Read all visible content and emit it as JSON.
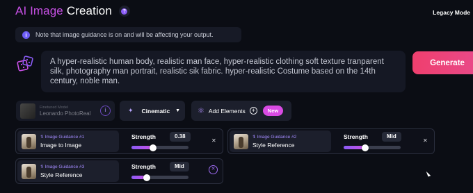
{
  "header": {
    "title_accent": "AI Image",
    "title_rest": "Creation",
    "legacy_label": "Legacy Mode"
  },
  "notice": {
    "text": "Note that image guidance is on and will be affecting your output."
  },
  "prompt": {
    "text": "A hyper-realistic human body, realistic man face, hyper-realistic clothing soft texture tranparent silk, photography man portrait, realistic sik fabric. hyper-realistic Costume based on the 14th century, noble man."
  },
  "generate_label": "Generate",
  "toolbar": {
    "model_small_label": "Finetuned Model",
    "model_name": "Leonardo PhotoReal",
    "style_value": "Cinematic",
    "add_elements_label": "Add Elements",
    "new_badge": "New"
  },
  "guidance": [
    {
      "title": "Image Guidance #1",
      "type": "Image to Image",
      "strength_label": "Strength",
      "strength_value": "0.38",
      "slider_fraction": 0.38
    },
    {
      "title": "Image Guidance #2",
      "type": "Style Reference",
      "strength_label": "Strength",
      "strength_value": "Mid",
      "slider_fraction": 0.38
    },
    {
      "title": "Image Guidance #3",
      "type": "Style Reference",
      "strength_label": "Strength",
      "strength_value": "Mid",
      "slider_fraction": 0.27
    }
  ],
  "colors": {
    "accent": "#c850e6",
    "generate": "#ef3f6e",
    "background": "#0b0d14"
  }
}
